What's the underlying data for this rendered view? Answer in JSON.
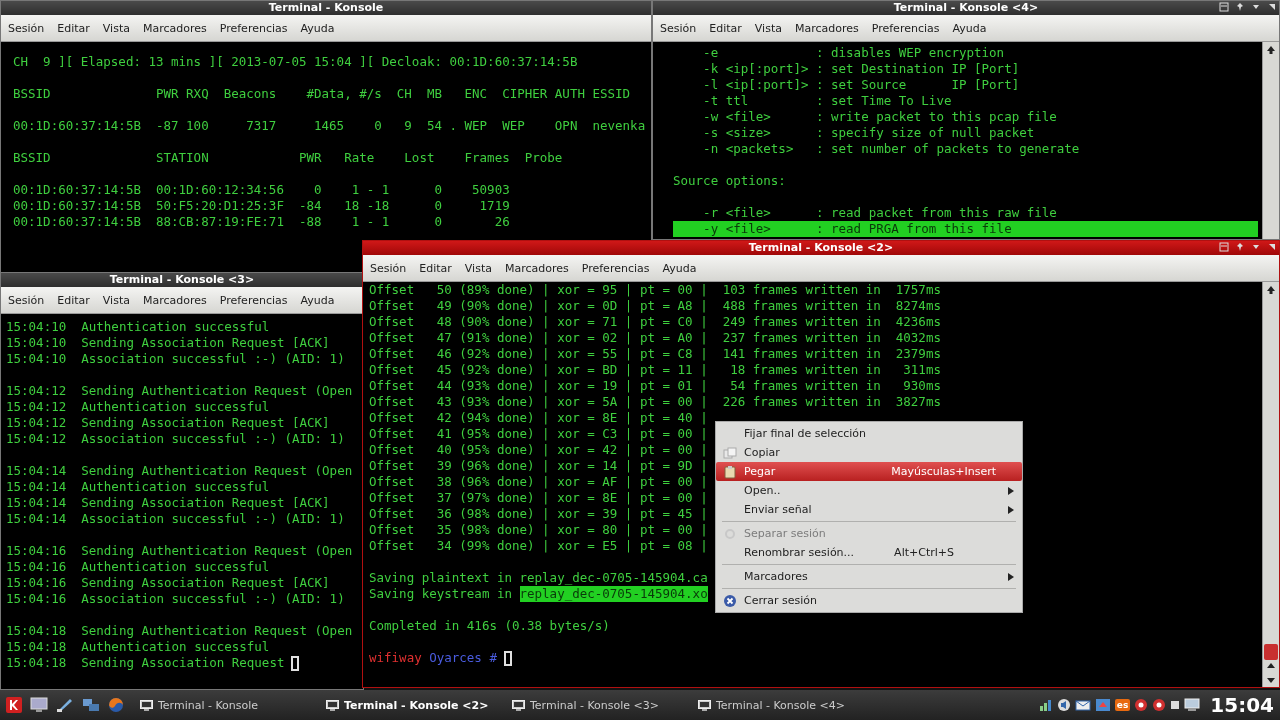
{
  "windows": [
    {
      "title": "Terminal - Konsole",
      "active": false,
      "menu": [
        "Sesión",
        "Editar",
        "Vista",
        "Marcadores",
        "Preferencias",
        "Ayuda"
      ],
      "blocks": [
        [
          "CH  9 ][ Elapsed: 13 mins ][ 2013-07-05 15:04 ][ Decloak: 00:1D:60:37:14:5B"
        ],
        [
          "BSSID              PWR RXQ  Beacons    #Data, #/s  CH  MB   ENC  CIPHER AUTH ESSID"
        ],
        [
          "00:1D:60:37:14:5B  -87 100     7317     1465    0   9  54 . WEP  WEP    OPN  nevenka"
        ],
        [
          "BSSID              STATION            PWR   Rate    Lost    Frames  Probe"
        ],
        [
          "00:1D:60:37:14:5B  00:1D:60:12:34:56    0    1 - 1      0    50903",
          "00:1D:60:37:14:5B  50:F5:20:D1:25:3F  -84   18 -18      0     1719",
          "00:1D:60:37:14:5B  88:CB:87:19:FE:71  -88    1 - 1      0       26"
        ]
      ]
    },
    {
      "title": "Terminal - Konsole <4>",
      "active": false,
      "menu": [
        "Sesión",
        "Editar",
        "Vista",
        "Marcadores",
        "Preferencias",
        "Ayuda"
      ],
      "blocks": [
        [
          {
            "text": "    -e             : disables WEP encryption",
            "selected": false
          },
          {
            "text": "    -k <ip[:port]> : set Destination IP [Port]",
            "selected": false
          },
          {
            "text": "    -l <ip[:port]> : set Source      IP [Port]",
            "selected": false
          },
          {
            "text": "    -t ttl         : set Time To Live",
            "selected": false
          },
          {
            "text": "    -w <file>      : write packet to this pcap file",
            "selected": false
          },
          {
            "text": "    -s <size>      : specify size of null packet",
            "selected": false
          },
          {
            "text": "    -n <packets>   : set number of packets to generate",
            "selected": false
          }
        ],
        [
          {
            "text": "Source options:",
            "selected": false
          }
        ],
        [
          {
            "text": "    -r <file>      : read packet from this raw file",
            "selected": false
          },
          {
            "text": "    -y <file>      : read PRGA from this file",
            "selected": true
          }
        ]
      ]
    },
    {
      "title": "Terminal - Konsole <3>",
      "active": false,
      "menu": [
        "Sesión",
        "Editar",
        "Vista",
        "Marcadores",
        "Preferencias",
        "Ayuda"
      ],
      "blocks": [
        [
          "15:04:10  Authentication successful",
          "15:04:10  Sending Association Request [ACK]",
          "15:04:10  Association successful :-) (AID: 1)"
        ],
        [
          "15:04:12  Sending Authentication Request (Open",
          "15:04:12  Authentication successful",
          "15:04:12  Sending Association Request [ACK]",
          "15:04:12  Association successful :-) (AID: 1)"
        ],
        [
          "15:04:14  Sending Authentication Request (Open",
          "15:04:14  Authentication successful",
          "15:04:14  Sending Association Request [ACK]",
          "15:04:14  Association successful :-) (AID: 1)"
        ],
        [
          "15:04:16  Sending Authentication Request (Open",
          "15:04:16  Authentication successful",
          "15:04:16  Sending Association Request [ACK]",
          "15:04:16  Association successful :-) (AID: 1)"
        ],
        [
          "15:04:18  Sending Authentication Request (Open",
          "15:04:18  Authentication successful",
          {
            "segments": [
              {
                "text": "15:04:18  Sending Association Request",
                "kind": "text"
              }
            ],
            "cursor": true
          }
        ]
      ]
    },
    {
      "title": "Terminal - Konsole <2>",
      "active": true,
      "menu": [
        "Sesión",
        "Editar",
        "Vista",
        "Marcadores",
        "Preferencias",
        "Ayuda"
      ],
      "blocks": [
        [
          "Offset   50 (89% done) | xor = 95 | pt = 00 |  103 frames written in  1757ms",
          "Offset   49 (90% done) | xor = 0D | pt = A8 |  488 frames written in  8274ms",
          "Offset   48 (90% done) | xor = 71 | pt = C0 |  249 frames written in  4236ms",
          "Offset   47 (91% done) | xor = 02 | pt = A0 |  237 frames written in  4032ms",
          "Offset   46 (92% done) | xor = 55 | pt = C8 |  141 frames written in  2379ms",
          "Offset   45 (92% done) | xor = BD | pt = 11 |   18 frames written in   311ms",
          "Offset   44 (93% done) | xor = 19 | pt = 01 |   54 frames written in   930ms",
          "Offset   43 (93% done) | xor = 5A | pt = 00 |  226 frames written in  3827ms",
          "Offset   42 (94% done) | xor = 8E | pt = 40 |",
          "Offset   41 (95% done) | xor = C3 | pt = 00 |",
          "Offset   40 (95% done) | xor = 42 | pt = 00 |",
          "Offset   39 (96% done) | xor = 14 | pt = 9D |",
          "Offset   38 (96% done) | xor = AF | pt = 00 |",
          "Offset   37 (97% done) | xor = 8E | pt = 00 |",
          "Offset   36 (98% done) | xor = 39 | pt = 45 |",
          "Offset   35 (98% done) | xor = 80 | pt = 00 |",
          "Offset   34 (99% done) | xor = E5 | pt = 08 |"
        ],
        [
          "Saving plaintext in replay_dec-0705-145904.ca",
          {
            "segments": [
              {
                "text": "Saving keystream in ",
                "kind": "text"
              },
              {
                "text": "replay_dec-0705-145904.xo",
                "kind": "selected"
              }
            ],
            "cursor": false
          }
        ],
        [
          "Completed in 416s (0.38 bytes/s)"
        ],
        [
          {
            "segments": [
              {
                "text": "wifiway",
                "kind": "host"
              },
              {
                "text": "Oyarces #",
                "kind": "path"
              }
            ],
            "cursor": true
          }
        ]
      ],
      "context_menu": {
        "items": [
          {
            "kind": "item",
            "label": "Fijar final de selección",
            "submenu": false,
            "disabled": false,
            "selected": false
          },
          {
            "kind": "item",
            "label": "Copiar",
            "submenu": false,
            "disabled": false,
            "selected": false
          },
          {
            "kind": "item",
            "label": "Pegar",
            "shortcut": "Mayúsculas+Insert",
            "submenu": false,
            "disabled": false,
            "selected": true
          },
          {
            "kind": "item",
            "label": "Open..",
            "submenu": true,
            "disabled": false,
            "selected": false
          },
          {
            "kind": "item",
            "label": "Enviar señal",
            "submenu": true,
            "disabled": false,
            "selected": false
          },
          {
            "kind": "separator"
          },
          {
            "kind": "item",
            "label": "Separar sesión",
            "submenu": false,
            "disabled": true,
            "selected": false
          },
          {
            "kind": "item",
            "label": "Renombrar sesión...",
            "shortcut": "Alt+Ctrl+S",
            "submenu": false,
            "disabled": false,
            "selected": false
          },
          {
            "kind": "separator"
          },
          {
            "kind": "item",
            "label": "Marcadores",
            "submenu": true,
            "disabled": false,
            "selected": false
          },
          {
            "kind": "separator"
          },
          {
            "kind": "item",
            "label": "Cerrar sesión",
            "submenu": false,
            "disabled": false,
            "selected": false
          }
        ]
      }
    }
  ],
  "taskbar": {
    "tasks": [
      {
        "label": "Terminal - Konsole",
        "selected": false
      },
      {
        "label": "Terminal - Konsole <2>",
        "selected": true
      },
      {
        "label": "Terminal - Konsole <3>",
        "selected": false
      },
      {
        "label": "Terminal - Konsole <4>",
        "selected": false
      }
    ],
    "keyboard_layout": "es",
    "clock": "15:04"
  }
}
